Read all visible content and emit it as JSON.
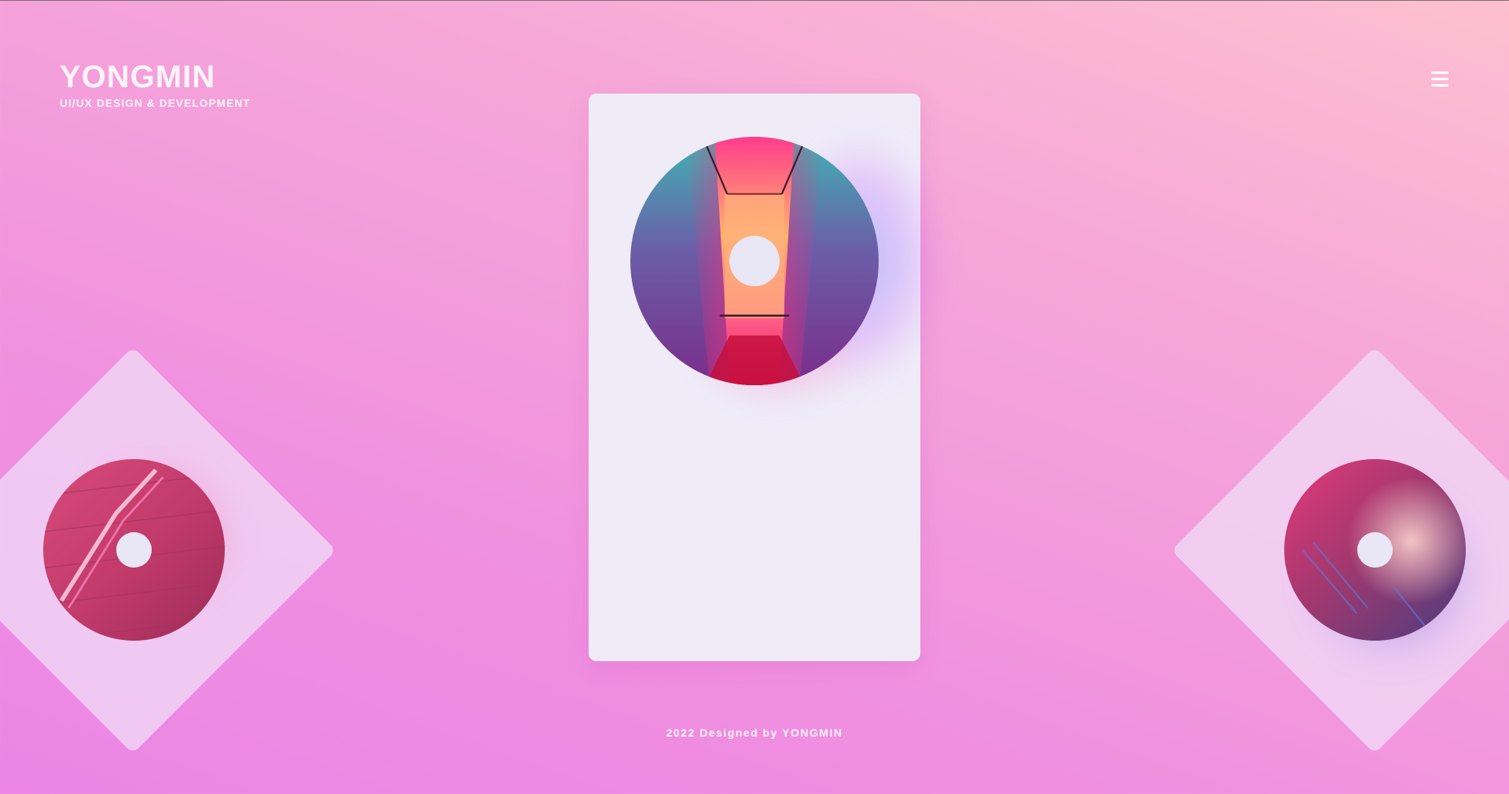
{
  "brand": {
    "title": "YONGMIN",
    "subtitle": "UI/UX DESIGN & DEVELOPMENT"
  },
  "header": {
    "menu_icon": "hamburger-menu-icon"
  },
  "cards": [
    {
      "id": "left",
      "image": "neon-sign-on-brick-wall",
      "active": false
    },
    {
      "id": "center",
      "image": "neon-pink-corridor",
      "active": true
    },
    {
      "id": "right",
      "image": "girl-in-neon-light",
      "active": false
    }
  ],
  "footer": {
    "credit": "2022 Designed by YONGMIN"
  },
  "colors": {
    "background_top": "#fdc0d0",
    "background_bottom": "#ec85e6",
    "card": "#efecf8",
    "text": "#fff4f9"
  }
}
